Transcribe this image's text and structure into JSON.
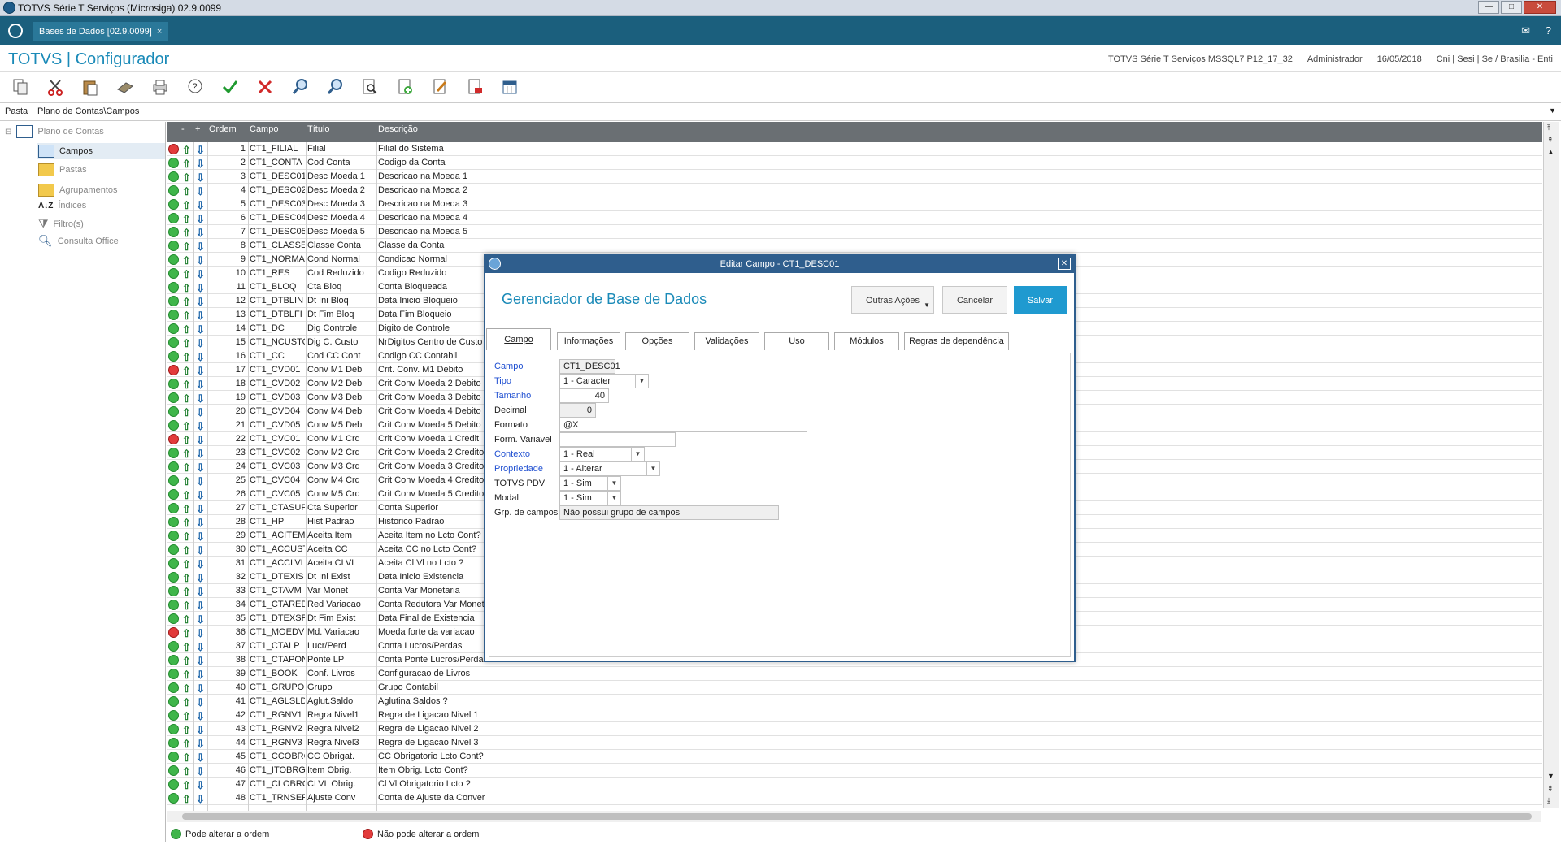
{
  "window": {
    "title": "TOTVS Série T Serviços (Microsiga) 02.9.0099",
    "btn_min": "—",
    "btn_max": "□",
    "btn_close": "✕"
  },
  "tabbar": {
    "tab_label": "Bases de Dados [02.9.0099]",
    "tab_close": "×",
    "mail_icon": "✉",
    "help_icon": "?"
  },
  "header": {
    "brand": "TOTVS | Configurador",
    "env": "TOTVS Série T Serviços MSSQL7 P12_17_32",
    "user": "Administrador",
    "date": "16/05/2018",
    "company": "Cni | Sesi | Se / Brasilia - Enti"
  },
  "toolbar": {
    "icons": [
      "copy-icon",
      "cut-icon",
      "paste-icon",
      "eraser-icon",
      "print-icon",
      "help-icon",
      "confirm-icon",
      "cancel-icon",
      "search-icon",
      "search-next-icon",
      "preview-icon",
      "add-icon",
      "edit-icon",
      "delete-icon",
      "calendar-icon"
    ]
  },
  "path": {
    "label": "Pasta",
    "value": "Plano de Contas\\Campos"
  },
  "tree": {
    "root": "Plano de Contas",
    "items": [
      "Campos",
      "Pastas",
      "Agrupamentos",
      "Índices",
      "Filtro(s)",
      "Consulta Office"
    ]
  },
  "grid": {
    "headers": {
      "minus": "-",
      "plus": "+",
      "ordem": "Ordem",
      "campo": "Campo",
      "titulo": "Título",
      "descricao": "Descrição"
    },
    "rows": [
      [
        "r",
        "1",
        "CT1_FILIAL",
        "Filial",
        "Filial do Sistema"
      ],
      [
        "g",
        "2",
        "CT1_CONTA",
        "Cod Conta",
        "Codigo da Conta"
      ],
      [
        "g",
        "3",
        "CT1_DESC01",
        "Desc Moeda 1",
        "Descricao na Moeda 1"
      ],
      [
        "g",
        "4",
        "CT1_DESC02",
        "Desc Moeda 2",
        "Descricao na Moeda 2"
      ],
      [
        "g",
        "5",
        "CT1_DESC03",
        "Desc Moeda 3",
        "Descricao na Moeda 3"
      ],
      [
        "g",
        "6",
        "CT1_DESC04",
        "Desc Moeda 4",
        "Descricao na Moeda 4"
      ],
      [
        "g",
        "7",
        "CT1_DESC05",
        "Desc Moeda 5",
        "Descricao na Moeda 5"
      ],
      [
        "g",
        "8",
        "CT1_CLASSE",
        "Classe Conta",
        "Classe da Conta"
      ],
      [
        "g",
        "9",
        "CT1_NORMAL",
        "Cond Normal",
        "Condicao Normal"
      ],
      [
        "g",
        "10",
        "CT1_RES",
        "Cod Reduzido",
        "Codigo Reduzido"
      ],
      [
        "g",
        "11",
        "CT1_BLOQ",
        "Cta Bloq",
        "Conta Bloqueada"
      ],
      [
        "g",
        "12",
        "CT1_DTBLIN",
        "Dt Ini Bloq",
        "Data Inicio Bloqueio"
      ],
      [
        "g",
        "13",
        "CT1_DTBLFI",
        "Dt Fim Bloq",
        "Data Fim Bloqueio"
      ],
      [
        "g",
        "14",
        "CT1_DC",
        "Dig Controle",
        "Digito de Controle"
      ],
      [
        "g",
        "15",
        "CT1_NCUSTO",
        "Dig C. Custo",
        "NrDigitos Centro de Custo"
      ],
      [
        "g",
        "16",
        "CT1_CC",
        "Cod CC Cont",
        "Codigo CC Contabil"
      ],
      [
        "r",
        "17",
        "CT1_CVD01",
        "Conv M1 Deb",
        "Crit. Conv. M1 Debito"
      ],
      [
        "g",
        "18",
        "CT1_CVD02",
        "Conv M2 Deb",
        "Crit Conv Moeda 2 Debito"
      ],
      [
        "g",
        "19",
        "CT1_CVD03",
        "Conv M3 Deb",
        "Crit Conv Moeda 3 Debito"
      ],
      [
        "g",
        "20",
        "CT1_CVD04",
        "Conv M4 Deb",
        "Crit Conv Moeda 4 Debito"
      ],
      [
        "g",
        "21",
        "CT1_CVD05",
        "Conv M5 Deb",
        "Crit Conv Moeda 5 Debito"
      ],
      [
        "r",
        "22",
        "CT1_CVC01",
        "Conv M1 Crd",
        "Crit Conv Moeda 1 Credit"
      ],
      [
        "g",
        "23",
        "CT1_CVC02",
        "Conv M2 Crd",
        "Crit Conv Moeda 2 Credito"
      ],
      [
        "g",
        "24",
        "CT1_CVC03",
        "Conv M3 Crd",
        "Crit Conv Moeda 3 Credito"
      ],
      [
        "g",
        "25",
        "CT1_CVC04",
        "Conv M4 Crd",
        "Crit Conv Moeda 4 Credito"
      ],
      [
        "g",
        "26",
        "CT1_CVC05",
        "Conv M5 Crd",
        "Crit Conv Moeda 5 Credito"
      ],
      [
        "g",
        "27",
        "CT1_CTASUP",
        "Cta Superior",
        "Conta Superior"
      ],
      [
        "g",
        "28",
        "CT1_HP",
        "Hist Padrao",
        "Historico Padrao"
      ],
      [
        "g",
        "29",
        "CT1_ACITEM",
        "Aceita Item",
        "Aceita Item no Lcto Cont?"
      ],
      [
        "g",
        "30",
        "CT1_ACCUST",
        "Aceita CC",
        "Aceita CC no Lcto Cont?"
      ],
      [
        "g",
        "31",
        "CT1_ACCLVL",
        "Aceita CLVL",
        "Aceita Cl Vl no Lcto ?"
      ],
      [
        "g",
        "32",
        "CT1_DTEXIS",
        "Dt Ini Exist",
        "Data Inicio Existencia"
      ],
      [
        "g",
        "33",
        "CT1_CTAVM",
        "Var Monet",
        "Conta Var Monetaria"
      ],
      [
        "g",
        "34",
        "CT1_CTARED",
        "Red Variacao",
        "Conta Redutora Var Monet"
      ],
      [
        "g",
        "35",
        "CT1_DTEXSF",
        "Dt Fim Exist",
        "Data Final de Existencia"
      ],
      [
        "r",
        "36",
        "CT1_MOEDVM",
        "Md. Variacao",
        "Moeda forte da variacao"
      ],
      [
        "g",
        "37",
        "CT1_CTALP",
        "Lucr/Perd",
        "Conta Lucros/Perdas"
      ],
      [
        "g",
        "38",
        "CT1_CTAPON",
        "Ponte LP",
        "Conta Ponte Lucros/Perdas"
      ],
      [
        "g",
        "39",
        "CT1_BOOK",
        "Conf. Livros",
        "Configuracao de Livros"
      ],
      [
        "g",
        "40",
        "CT1_GRUPO",
        "Grupo",
        "Grupo Contabil"
      ],
      [
        "g",
        "41",
        "CT1_AGLSLD",
        "Aglut.Saldo",
        "Aglutina Saldos       ?"
      ],
      [
        "g",
        "42",
        "CT1_RGNV1",
        "Regra Nivel1",
        "Regra de Ligacao Nivel 1"
      ],
      [
        "g",
        "43",
        "CT1_RGNV2",
        "Regra Nivel2",
        "Regra de Ligacao Nivel 2"
      ],
      [
        "g",
        "44",
        "CT1_RGNV3",
        "Regra Nivel3",
        "Regra de Ligacao Nivel 3"
      ],
      [
        "g",
        "45",
        "CT1_CCOBRG",
        "CC Obrigat.",
        "CC Obrigatorio Lcto Cont?"
      ],
      [
        "g",
        "46",
        "CT1_ITOBRG",
        "Item Obrig.",
        "Item Obrig. Lcto Cont?"
      ],
      [
        "g",
        "47",
        "CT1_CLOBRG",
        "CLVL Obrig.",
        "Cl Vl Obrigatorio Lcto ?"
      ],
      [
        "g",
        "48",
        "CT1_TRNSEF",
        "Ajuste Conv",
        "Conta de Ajuste da Conver"
      ]
    ]
  },
  "legend": {
    "can": "Pode alterar a ordem",
    "cannot": "Não pode alterar a ordem"
  },
  "dialog": {
    "title": "Editar Campo - CT1_DESC01",
    "close": "✕",
    "heading": "Gerenciador de Base de Dados",
    "btn_outras": "Outras Ações",
    "btn_cancelar": "Cancelar",
    "btn_salvar": "Salvar",
    "tabs": [
      "Campo",
      "Informações",
      "Opções",
      "Validações",
      "Uso",
      "Módulos",
      "Regras de dependência"
    ],
    "fields": {
      "campo_label": "Campo",
      "campo": "CT1_DESC01",
      "tipo_label": "Tipo",
      "tipo": "1 - Caracter",
      "tamanho_label": "Tamanho",
      "tamanho": "40",
      "decimal_label": "Decimal",
      "decimal": "0",
      "formato_label": "Formato",
      "formato": "@X",
      "formvar_label": "Form. Variavel",
      "formvar": "",
      "contexto_label": "Contexto",
      "contexto": "1 - Real",
      "propriedade_label": "Propriedade",
      "propriedade": "1 - Alterar",
      "pdv_label": "TOTVS PDV",
      "pdv": "1 - Sim",
      "modal_label": "Modal",
      "modal": "1 - Sim",
      "grupo_label": "Grp. de campos",
      "grupo": "Não possui grupo de campos"
    }
  }
}
